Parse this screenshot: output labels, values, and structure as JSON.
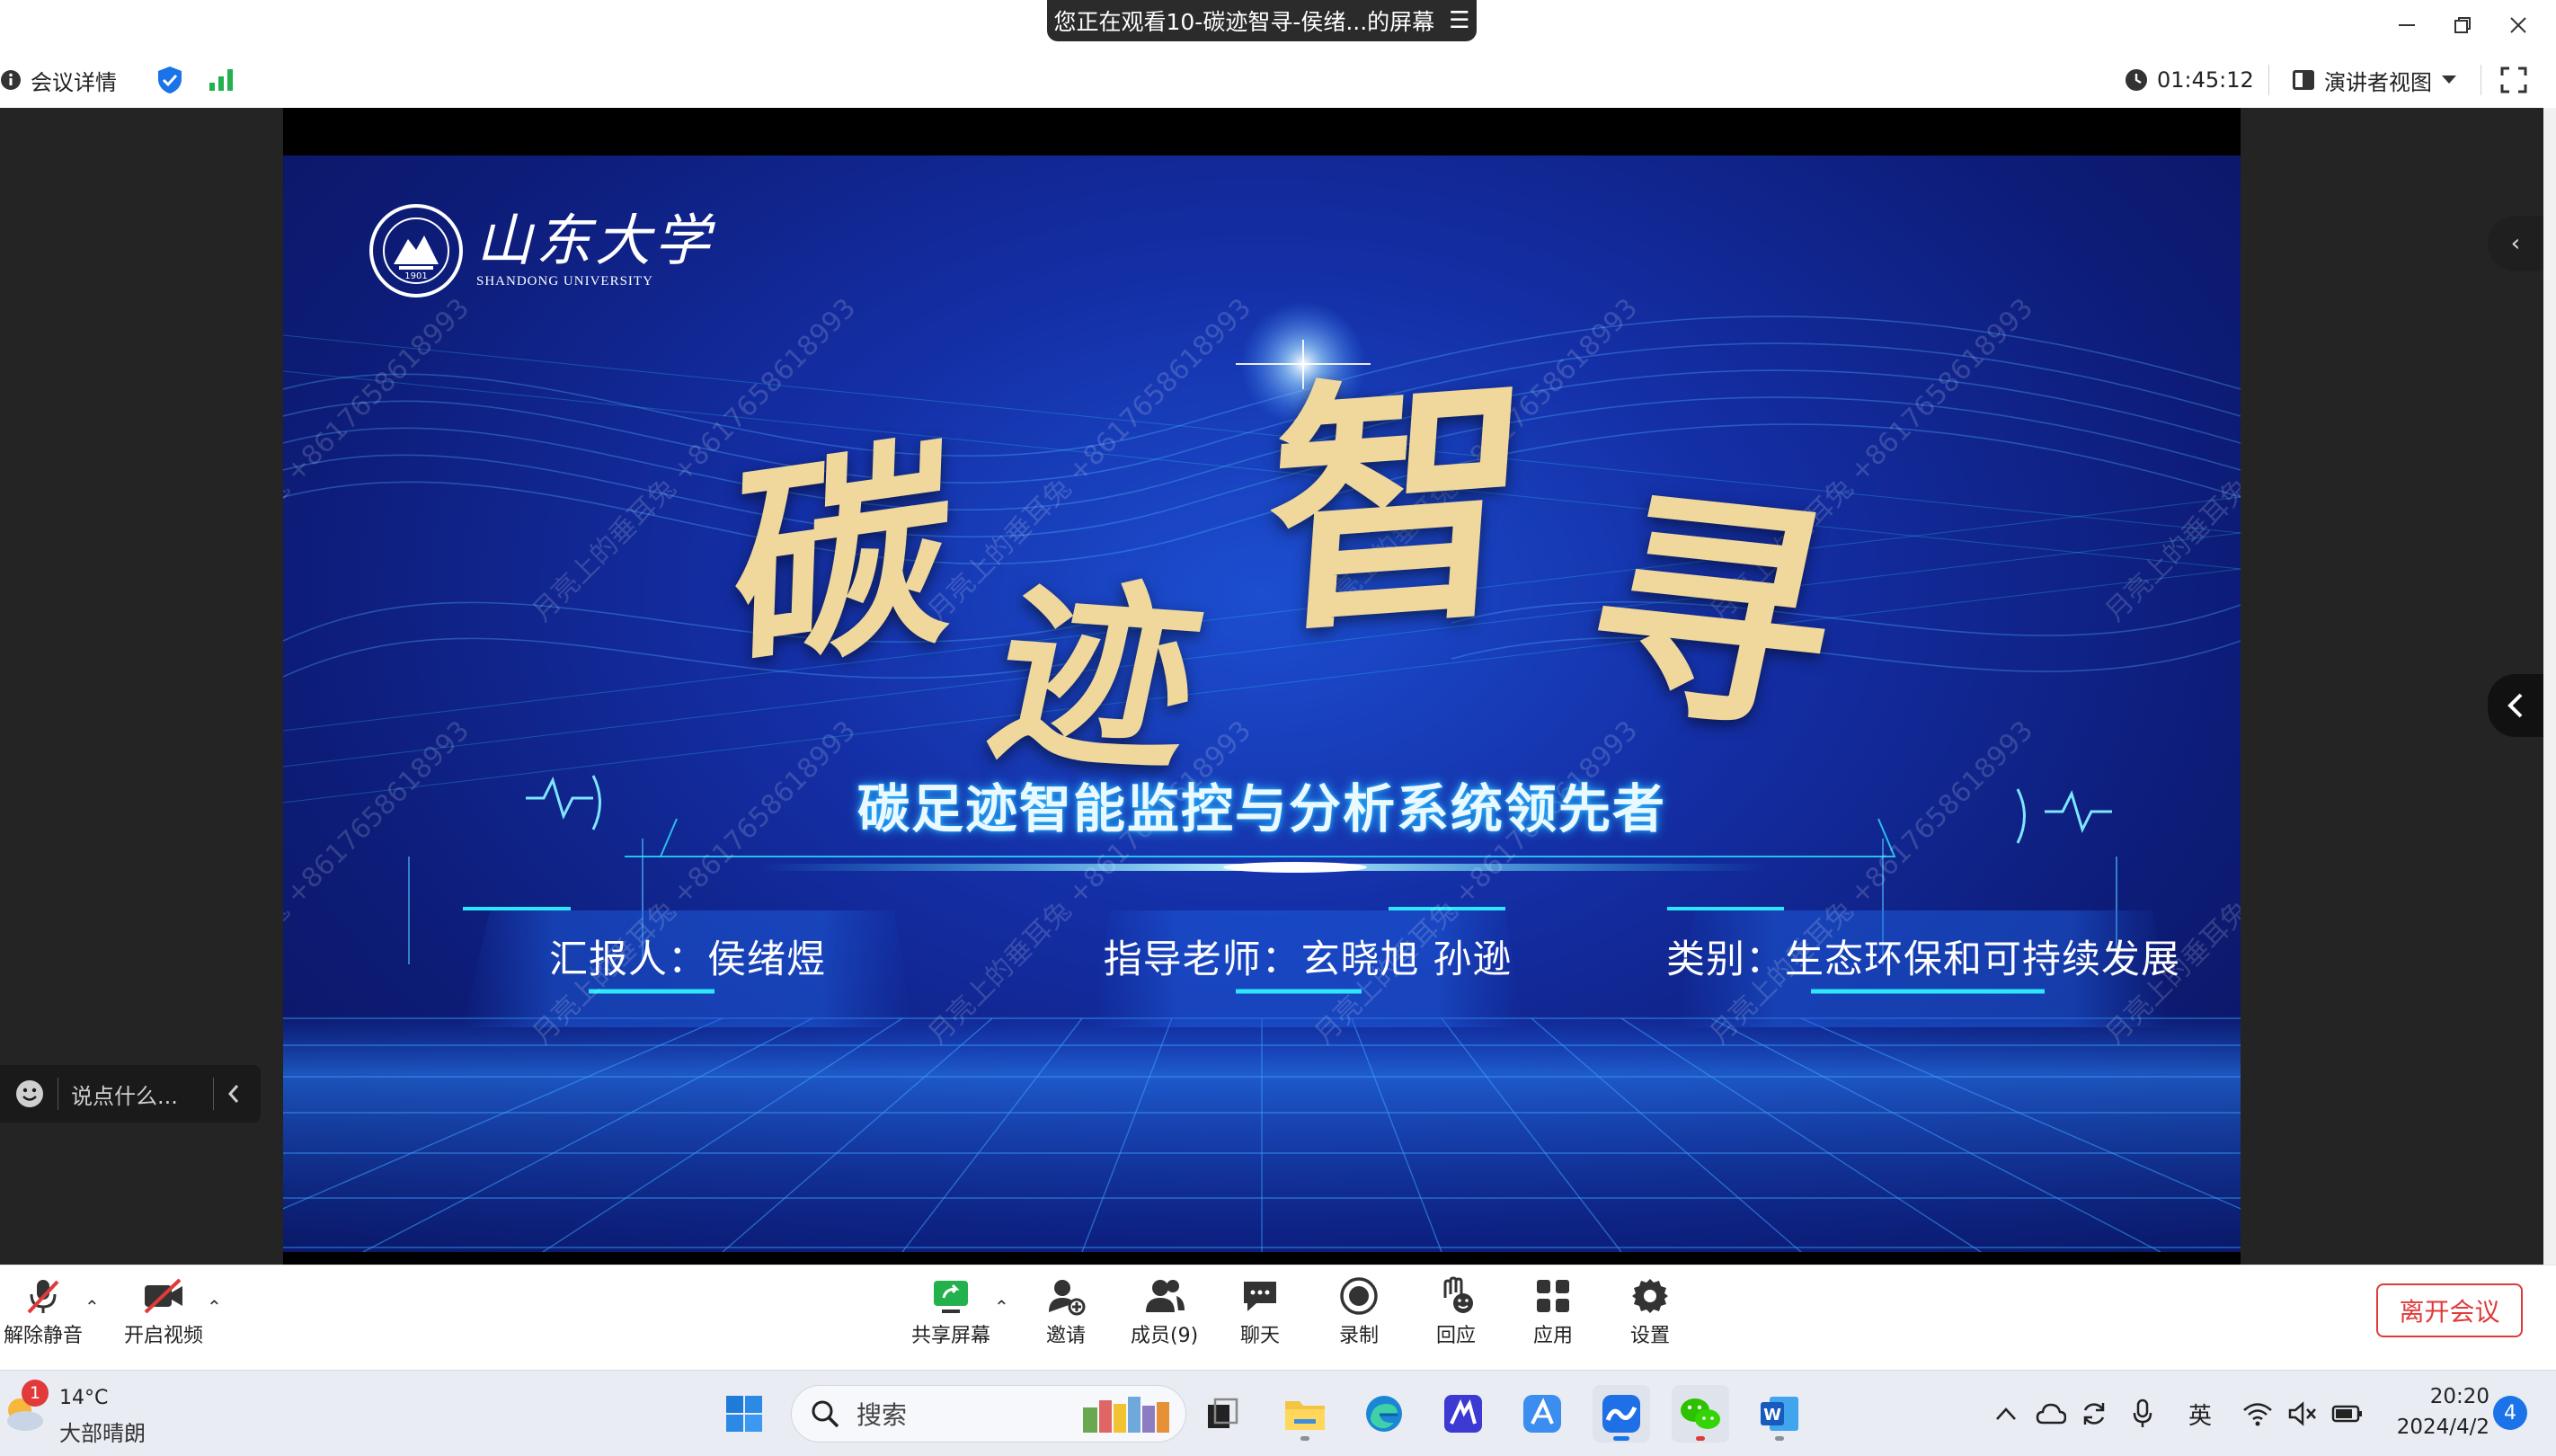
{
  "title_bar": {
    "share_indicator": "您正在观看10-碳迹智寻-侯绪...的屏幕",
    "menu_icon": "hamburger-menu-icon",
    "window_controls": [
      "minimize-icon",
      "restore-icon",
      "close-icon"
    ]
  },
  "meeting_bar": {
    "meeting_details_label": "会议详情",
    "security_icon": "shield-check-icon",
    "signal_icon": "signal-bars-icon",
    "timer": "01:45:12",
    "view_mode_label": "演讲者视图",
    "fullscreen_icon": "fullscreen-icon"
  },
  "slide": {
    "university_logo_text": "山东大学",
    "university_name_en": "SHANDONG UNIVERSITY",
    "logo_year": "1901",
    "main_title": [
      "碳",
      "迹",
      "智",
      "寻"
    ],
    "subtitle": "碳足迹智能监控与分析系统领先者",
    "info_panels": [
      {
        "text": "汇报人：侯绪煜"
      },
      {
        "text": "指导老师：玄晓旭 孙逊"
      },
      {
        "text": "类别：生态环保和可持续发展"
      }
    ],
    "watermark": "月亮上的垂耳兔 +8617658618993"
  },
  "chat": {
    "placeholder": "说点什么..."
  },
  "controls": {
    "unmute_label": "解除静音",
    "start_video_label": "开启视频",
    "share_screen_label": "共享屏幕",
    "invite_label": "邀请",
    "members_label": "成员(9)",
    "chat_label": "聊天",
    "record_label": "录制",
    "react_label": "回应",
    "apps_label": "应用",
    "settings_label": "设置",
    "leave_label": "离开会议"
  },
  "taskbar": {
    "weather_badge": "1",
    "weather_temp": "14°C",
    "weather_desc": "大部晴朗",
    "search_placeholder": "搜索",
    "apps": [
      "windows-start-icon",
      "search-icon",
      "task-view-icon",
      "file-explorer-icon",
      "edge-browser-icon",
      "meeting-app-icon",
      "feishu-icon",
      "tencent-meeting-icon",
      "wechat-icon",
      "word-icon"
    ],
    "ime": "英",
    "time": "20:20",
    "date": "2024/4/2",
    "notification_count": "4"
  },
  "colors": {
    "accent_blue": "#1a73e8",
    "leave_red": "#e03a3a",
    "slide_gold": "#e9cf8f",
    "slide_cyan": "#2ee6ff",
    "signal_green": "#22b14c"
  }
}
